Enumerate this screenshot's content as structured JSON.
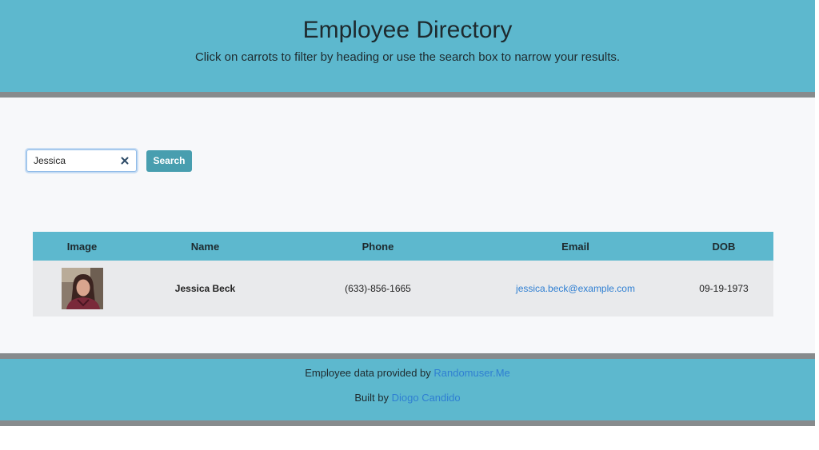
{
  "header": {
    "title": "Employee Directory",
    "subtitle": "Click on carrots to filter by heading or use the search box to narrow your results."
  },
  "search": {
    "value": "Jessica",
    "clear_icon": "close-icon",
    "button_label": "Search"
  },
  "table": {
    "columns": [
      "Image",
      "Name",
      "Phone",
      "Email",
      "DOB"
    ],
    "rows": [
      {
        "image": "avatar-photo",
        "name": "Jessica Beck",
        "phone": "(633)-856-1665",
        "email": "jessica.beck@example.com",
        "dob": "09-19-1973"
      }
    ]
  },
  "footer": {
    "line1_text": "Employee data provided by ",
    "line1_link": "Randomuser.Me",
    "line2_text": "Built by ",
    "line2_link": "Diogo Candido"
  },
  "colors": {
    "header_bg": "#5db8ce",
    "divider": "#878b8d",
    "button_bg": "#489eaf",
    "link": "#2f7fd2"
  }
}
